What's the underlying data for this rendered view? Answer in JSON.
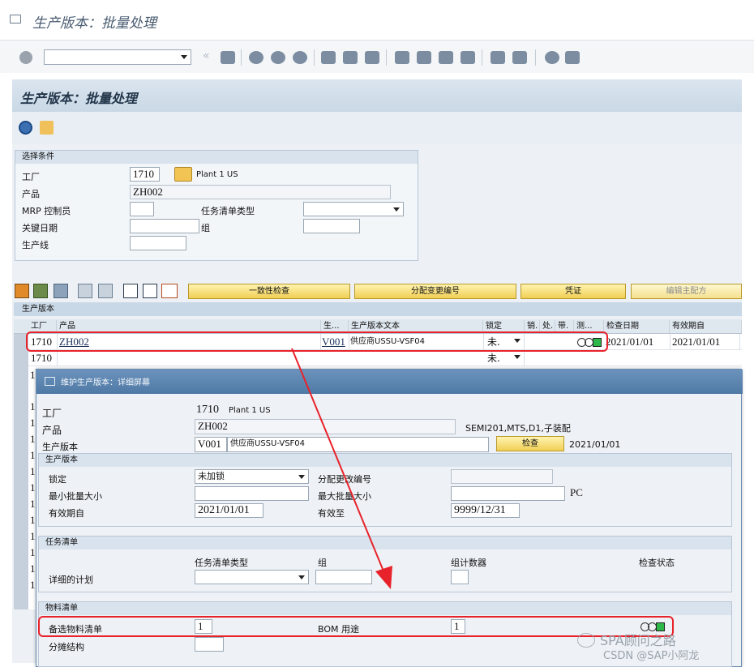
{
  "window": {
    "title": "生产版本：批量处理"
  },
  "toolbar": {
    "command_value": ""
  },
  "page": {
    "title": "生产版本：批量处理"
  },
  "selection": {
    "title": "选择条件",
    "plant_label": "工厂",
    "plant_value": "1710",
    "plant_desc": "Plant 1 US",
    "product_label": "产品",
    "product_value": "ZH002",
    "mrp_label": "MRP 控制员",
    "mrp_value": "",
    "task_list_type_label": "任务清单类型",
    "task_list_type_value": "",
    "key_date_label": "关键日期",
    "key_date_value": "",
    "group_label": "组",
    "group_value": "",
    "line_label": "生产线",
    "line_value": ""
  },
  "actions": {
    "consistency": "一致性检查",
    "assign_change": "分配变更编号",
    "document": "凭证",
    "edit_master": "编辑主配方"
  },
  "grid": {
    "title": "生产版本",
    "headers": {
      "plant": "工厂",
      "product": "产品",
      "version": "生...",
      "version_text": "生产版本文本",
      "lock": "锁定",
      "c1": "销.",
      "c2": "处.",
      "c3": "带.",
      "c4": "测...",
      "check_date": "检查日期",
      "valid_from": "有效期自"
    },
    "rows": [
      {
        "plant": "1710",
        "product": "ZH002",
        "version": "V001",
        "text": "供应商USSU-VSF04",
        "lock": "未.",
        "check_date": "2021/01/01",
        "valid_from": "2021/01/01"
      },
      {
        "plant": "1710",
        "product": "",
        "version": "",
        "text": "",
        "lock": "未.",
        "check_date": "",
        "valid_from": ""
      }
    ],
    "row_stub": "1"
  },
  "dialog": {
    "title": "维护生产版本：详细屏幕",
    "plant_label": "工厂",
    "plant_value": "1710",
    "plant_desc": "Plant 1 US",
    "product_label": "产品",
    "product_value": "ZH002",
    "product_desc": "SEMI201,MTS,D1,子装配",
    "version_label": "生产版本",
    "version_value": "V001",
    "version_text": "供应商USSU-VSF04",
    "check_button": "检查",
    "check_date": "2021/01/01",
    "prodver": {
      "title": "生产版本",
      "lock_label": "锁定",
      "lock_value": "未加锁",
      "assign_label": "分配更改编号",
      "assign_value": "",
      "min_lot_label": "最小批量大小",
      "min_lot_value": "",
      "max_lot_label": "最大批量大小",
      "max_lot_value": "",
      "unit": "PC",
      "valid_from_label": "有效期自",
      "valid_from_value": "2021/01/01",
      "valid_to_label": "有效至",
      "valid_to_value": "9999/12/31"
    },
    "tasklist": {
      "title": "任务清单",
      "type_hdr": "任务清单类型",
      "group_hdr": "组",
      "counter_hdr": "组计数器",
      "status_hdr": "检查状态",
      "detail_label": "详细的计划"
    },
    "bom": {
      "title": "物料清单",
      "alt_label": "备选物料清单",
      "alt_value": "1",
      "usage_label": "BOM 用途",
      "usage_value": "1",
      "split_label": "分摊结构",
      "split_value": ""
    }
  },
  "watermark": {
    "line1": "SPA顾问之路",
    "line2": "CSDN @SAP小阿龙"
  },
  "colors": {
    "highlight": "#e8222a",
    "header_band": "#c9d8e6",
    "dialog_title": "#4f7aa6",
    "status_green": "#2fb84a"
  }
}
